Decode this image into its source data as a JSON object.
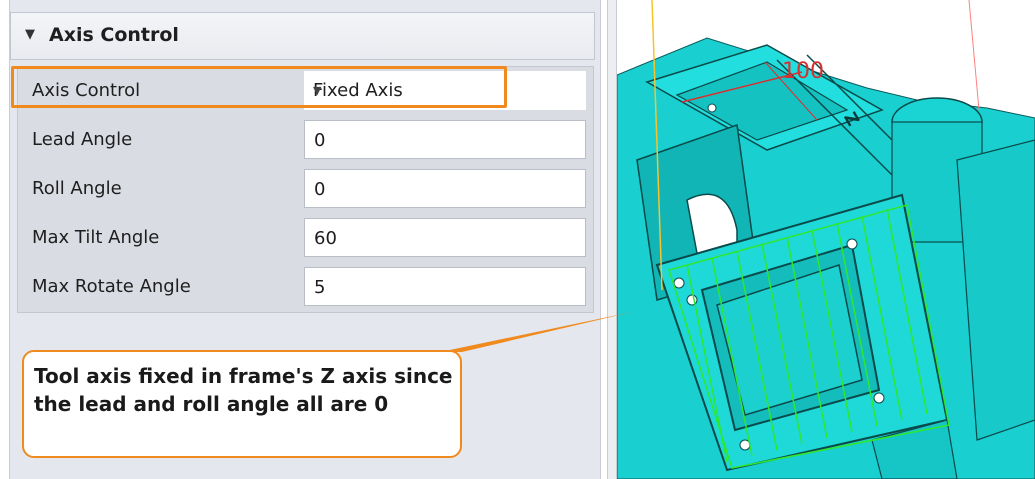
{
  "section": {
    "title": "Axis Control",
    "toggle_icon": "collapse-triangle-icon"
  },
  "properties": [
    {
      "label": "Axis Control",
      "value": "Fixed Axis",
      "type": "dropdown"
    },
    {
      "label": "Lead Angle",
      "value": "0",
      "type": "input"
    },
    {
      "label": "Roll Angle",
      "value": "0",
      "type": "input"
    },
    {
      "label": "Max Tilt Angle",
      "value": "60",
      "type": "input"
    },
    {
      "label": "Max Rotate Angle",
      "value": "5",
      "type": "input"
    }
  ],
  "callout": {
    "text": "Tool axis fixed in frame's Z axis since the lead and roll angle all are 0"
  },
  "viewport": {
    "dimension_label": "100",
    "axis_label": "Z",
    "part_color": "#19cfcf",
    "toolpath_color": "#2ee82e",
    "highlight_color": "#f08a1f"
  }
}
